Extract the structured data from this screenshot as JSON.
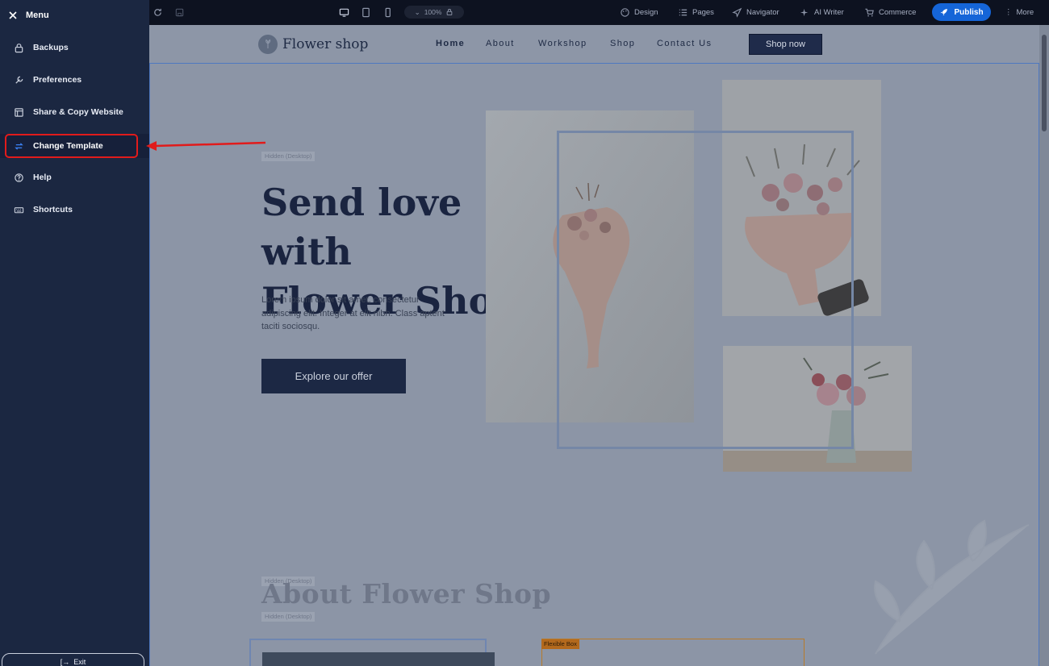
{
  "menu": {
    "title": "Menu",
    "items": [
      {
        "label": "Backups",
        "icon": "lock-icon"
      },
      {
        "label": "Preferences",
        "icon": "wrench-icon"
      },
      {
        "label": "Share & Copy Website",
        "icon": "window-icon"
      },
      {
        "label": "Change Template",
        "icon": "swap-icon",
        "active": true
      },
      {
        "label": "Help",
        "icon": "help-circle-icon"
      },
      {
        "label": "Shortcuts",
        "icon": "keyboard-icon"
      }
    ],
    "exit_label": "Exit"
  },
  "toolbar": {
    "zoom": "100%",
    "menus": [
      "Design",
      "Pages",
      "Navigator",
      "AI Writer",
      "Commerce"
    ],
    "publish_label": "Publish",
    "more_label": "More"
  },
  "site": {
    "logo_text": "Flower shop",
    "nav_links": [
      "Home",
      "About",
      "Workshop",
      "Shop",
      "Contact Us"
    ],
    "nav_cta": "Shop now",
    "hidden_tag": "Hidden (Desktop)",
    "hero_title_line1": "Send love with",
    "hero_title_line2": "Flower Shop",
    "hero_text": "Lorem ipsum dolor sit amet, consectetur adipiscing elit. Integer at elit nibh. Class aptent taciti sociosqu.",
    "hero_button": "Explore our offer",
    "about_title": "About Flower Shop",
    "flex_box_tag": "Flexible Box"
  },
  "colors": {
    "sidebar_bg": "#1b2741",
    "toolbar_bg": "#0d1220",
    "publish_blue": "#1565d8",
    "highlight_red": "#e11b1b",
    "site_navy": "#1c2844"
  }
}
